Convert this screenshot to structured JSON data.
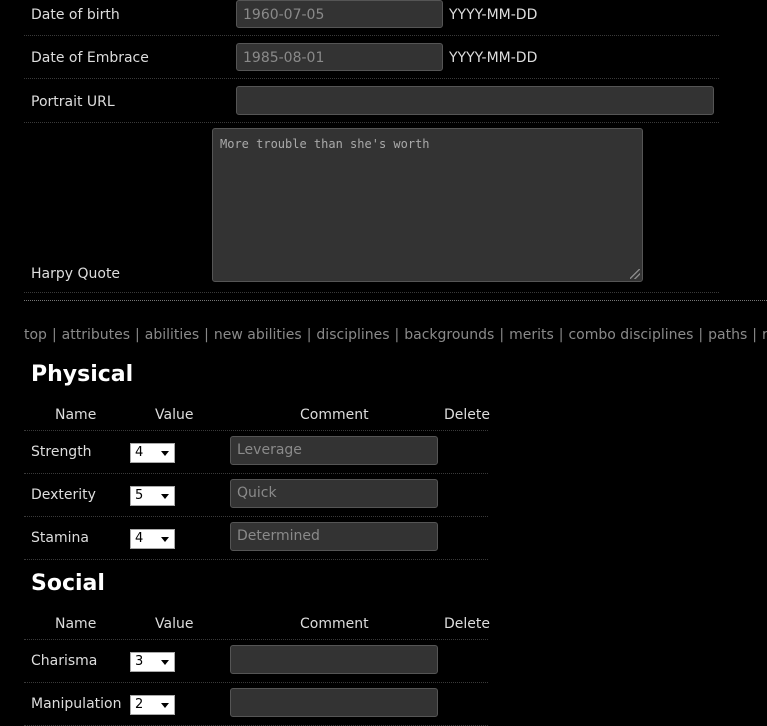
{
  "form": {
    "dob": {
      "label": "Date of birth",
      "value": "1960-07-05",
      "hint": "YYYY-MM-DD"
    },
    "doe": {
      "label": "Date of Embrace",
      "value": "1985-08-01",
      "hint": "YYYY-MM-DD"
    },
    "portrait": {
      "label": "Portrait URL",
      "value": ""
    },
    "quote": {
      "label": "Harpy Quote",
      "value": "More trouble than she's worth"
    }
  },
  "nav": [
    "top",
    "attributes",
    "abilities",
    "new abilities",
    "disciplines",
    "backgrounds",
    "merits",
    "combo disciplines",
    "paths",
    "r"
  ],
  "table_headers": {
    "name": "Name",
    "value": "Value",
    "comment": "Comment",
    "delete": "Delete"
  },
  "physical": {
    "title": "Physical",
    "rows": [
      {
        "name": "Strength",
        "value": "4",
        "comment": "Leverage"
      },
      {
        "name": "Dexterity",
        "value": "5",
        "comment": "Quick"
      },
      {
        "name": "Stamina",
        "value": "4",
        "comment": "Determined"
      }
    ]
  },
  "social": {
    "title": "Social",
    "rows": [
      {
        "name": "Charisma",
        "value": "3",
        "comment": ""
      },
      {
        "name": "Manipulation",
        "value": "2",
        "comment": ""
      }
    ]
  }
}
